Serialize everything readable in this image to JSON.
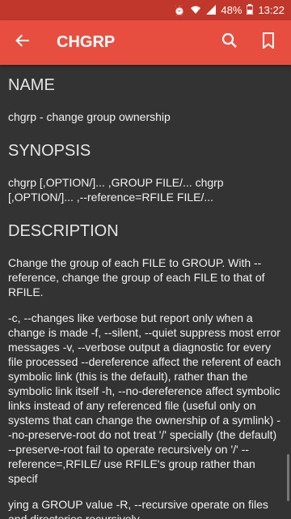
{
  "status_bar": {
    "battery_percent": "48%",
    "time": "13:22",
    "icons": [
      "alarm-icon",
      "wifi-icon",
      "signal-icon",
      "battery-icon"
    ]
  },
  "app_bar": {
    "title": "CHGRP",
    "back_icon": "back-arrow-icon",
    "search_icon": "search-icon",
    "bookmark_icon": "bookmark-icon",
    "background": "#e84e3f",
    "status_background": "#c1372b"
  },
  "sections": {
    "name": {
      "heading": "NAME",
      "text": "chgrp - change group ownership"
    },
    "synopsis": {
      "heading": "SYNOPSIS",
      "text": "chgrp [,OPTION/]... ,GROUP FILE/... chgrp [,OPTION/]... ,--reference=RFILE FILE/..."
    },
    "description": {
      "heading": "DESCRIPTION",
      "para1": "Change the group of each FILE to GROUP. With --reference, change the group of each FILE to that of RFILE.",
      "para2": "-c, --changes like verbose but report only when a change is made -f, --silent, --quiet suppress most error messages -v, --verbose output a diagnostic for every file processed --dereference affect the referent of each symbolic link (this is the default), rather than the symbolic link itself -h, --no-dereference affect symbolic links instead of any referenced file (useful only on systems that can change the ownership of a symlink) --no-preserve-root do not treat '/' specially (the default) --preserve-root fail to operate recursively on '/' --reference=,RFILE/ use RFILE's group rather than specif",
      "para3": "ying a GROUP value -R, --recursive operate on files and directories recursively"
    }
  }
}
